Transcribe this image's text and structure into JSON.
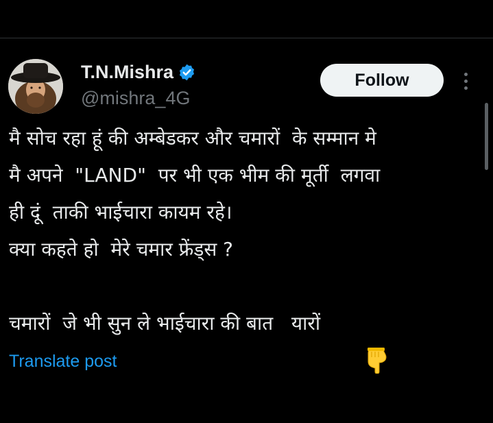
{
  "author": {
    "display_name": "T.N.Mishra",
    "handle": "@mishra_4G",
    "verified": true
  },
  "actions": {
    "follow_label": "Follow",
    "more_icon": "more-vertical-icon"
  },
  "tweet": {
    "lines": [
      "मै सोच रहा हूं की अम्बेडकर और चमारों  के सम्मान मे",
      "मै अपने  \"LAND\"  पर भी एक भीम की मूर्ती  लगवा",
      "ही दूं  ताकी भाईचारा कायम रहे।",
      "क्या कहते हो  मेरे चमार फ्रेंड्स ?",
      "",
      "चमारों  जे भी सुन ले भाईचारा की बात   यारों"
    ],
    "emoji": "backhand-index-pointing-down-icon"
  },
  "translate_label": "Translate post",
  "colors": {
    "background": "#000000",
    "text": "#e7e9ea",
    "secondary_text": "#71767b",
    "link": "#1d9bf0",
    "verified_badge": "#1d9bf0",
    "follow_bg": "#eff3f4"
  }
}
